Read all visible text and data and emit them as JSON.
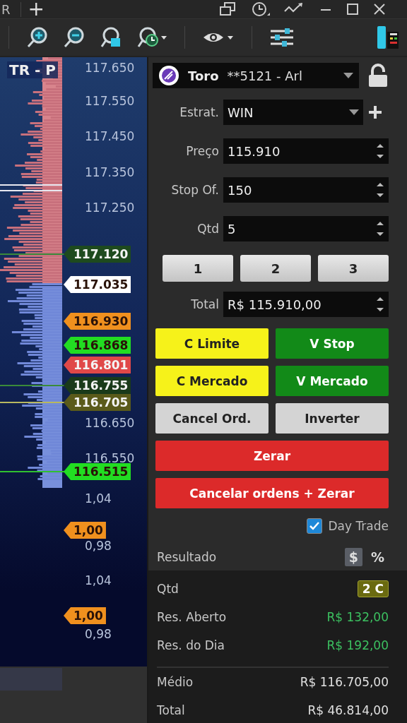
{
  "title_bar": {
    "tab_label": "R",
    "new_tab": "+"
  },
  "chart": {
    "title": "TR - P",
    "axis": [
      {
        "kind": "label",
        "text": "117.650"
      },
      {
        "kind": "label",
        "text": "117.550"
      },
      {
        "kind": "label",
        "text": "117.450"
      },
      {
        "kind": "label",
        "text": "117.350"
      },
      {
        "kind": "label",
        "text": "117.250"
      },
      {
        "kind": "tag",
        "text": "117.120",
        "color": "#1e4a1e"
      },
      {
        "kind": "tag",
        "text": "117.035",
        "color": "#ffffff"
      },
      {
        "kind": "tag",
        "text": "116.930",
        "color": "#f0901e"
      },
      {
        "kind": "tag",
        "text": "116.868",
        "color": "#22dd22"
      },
      {
        "kind": "tag",
        "text": "116.801",
        "color": "#e04848"
      },
      {
        "kind": "tag",
        "text": "116.755",
        "color": "#1a3a1a"
      },
      {
        "kind": "tag",
        "text": "116.705",
        "color": "#5a5a1a"
      },
      {
        "kind": "label",
        "text": "116.650"
      },
      {
        "kind": "label",
        "text": "116.550"
      },
      {
        "kind": "tag",
        "text": "116.515",
        "color": "#22dd22"
      },
      {
        "kind": "label",
        "text": "1,04"
      },
      {
        "kind": "tag",
        "text": "1,00",
        "color": "#f0901e"
      },
      {
        "kind": "label",
        "text": "0,98"
      },
      {
        "kind": "label",
        "text": "1,04"
      },
      {
        "kind": "tag",
        "text": "1,00",
        "color": "#f0901e"
      },
      {
        "kind": "label",
        "text": "0,98"
      }
    ]
  },
  "order_panel": {
    "account": {
      "broker": "Toro",
      "number": "**5121 - Arl"
    },
    "locked": false,
    "strategy": {
      "label": "Estrat.",
      "value": "WIN"
    },
    "fields": [
      {
        "label": "Preço",
        "value": "115.910"
      },
      {
        "label": "Stop Of.",
        "value": "150"
      },
      {
        "label": "Qtd",
        "value": "5"
      }
    ],
    "quick_qty": [
      "1",
      "2",
      "3"
    ],
    "total": {
      "label": "Total",
      "value": "R$ 115.910,00"
    },
    "actions": [
      {
        "label": "C Limite",
        "kind": "buy"
      },
      {
        "label": "V Stop",
        "kind": "sell"
      },
      {
        "label": "C Mercado",
        "kind": "buy"
      },
      {
        "label": "V Mercado",
        "kind": "sell"
      },
      {
        "label": "Cancel Ord.",
        "kind": "neutral"
      },
      {
        "label": "Inverter",
        "kind": "neutral"
      },
      {
        "label": "Zerar",
        "kind": "danger"
      },
      {
        "label": "Cancelar ordens + Zerar",
        "kind": "danger"
      }
    ],
    "day_trade": {
      "label": "Day Trade",
      "checked": true
    },
    "result": {
      "label": "Resultado",
      "units": [
        {
          "label": "$",
          "selected": true
        },
        {
          "label": "%",
          "selected": false
        }
      ]
    },
    "stats": [
      {
        "label": "Qtd",
        "value": "2 C",
        "kind": "badge"
      },
      {
        "label": "Res. Aberto",
        "value": "R$ 132,00",
        "kind": "positive"
      },
      {
        "label": "Res. do Dia",
        "value": "R$ 192,00",
        "kind": "positive"
      },
      {
        "label": "Médio",
        "value": "R$ 116.705,00",
        "kind": "plain"
      },
      {
        "label": "Total",
        "value": "R$ 46.814,00",
        "kind": "plain"
      }
    ]
  }
}
